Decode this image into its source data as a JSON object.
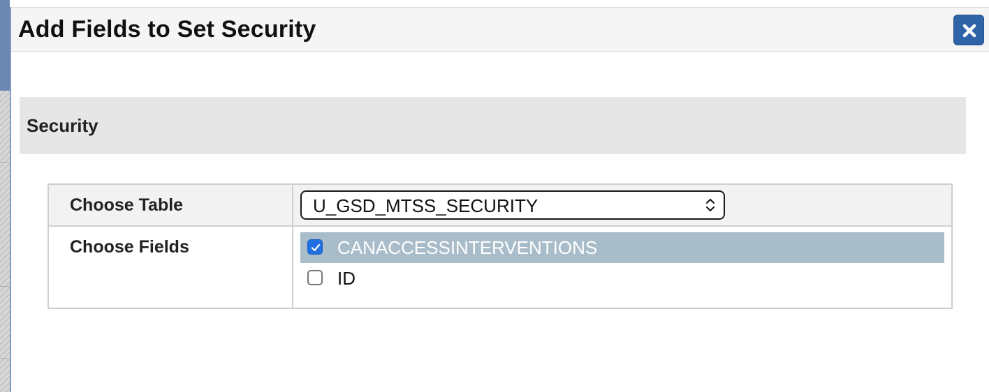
{
  "dialog": {
    "title": "Add Fields to Set Security",
    "close_icon": "close-icon"
  },
  "section": {
    "title": "Security"
  },
  "form": {
    "choose_table": {
      "label": "Choose Table",
      "selected_value": "U_GSD_MTSS_SECURITY",
      "icon": "updown-chevron-icon"
    },
    "choose_fields": {
      "label": "Choose Fields",
      "items": [
        {
          "label": "CANACCESSINTERVENTIONS",
          "checked": true,
          "selected": true
        },
        {
          "label": "ID",
          "checked": false,
          "selected": false
        }
      ]
    }
  },
  "colors": {
    "close_button": "#2f63a8",
    "selected_row": "#a8bdc9",
    "checkbox_checked": "#1f6fe0",
    "section_header_bg": "#e6e6e6"
  }
}
